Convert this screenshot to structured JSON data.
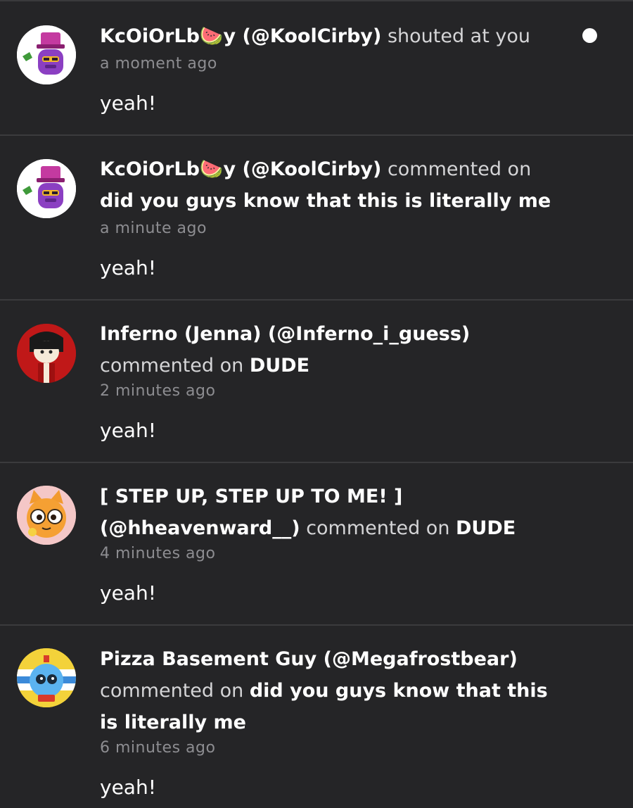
{
  "notifications": [
    {
      "author": "KcOiOrLb🍉y (@KoolCirby)",
      "action": " shouted at you",
      "target": "",
      "time": "a moment ago",
      "message": "yeah!",
      "unread": true,
      "avatar_icon": "purple-wizard-avatar-icon"
    },
    {
      "author": "KcOiOrLb🍉y (@KoolCirby)",
      "action": " commented on ",
      "target": "did you guys know that this is literally me",
      "time": "a minute ago",
      "message": "yeah!",
      "unread": false,
      "avatar_icon": "purple-wizard-avatar-icon"
    },
    {
      "author": "Inferno (Jenna) (@Inferno_i_guess)",
      "action": " commented on ",
      "target": "DUDE",
      "time": "2 minutes ago",
      "message": "yeah!",
      "unread": false,
      "avatar_icon": "red-character-avatar-icon"
    },
    {
      "author": "[ STEP UP, STEP UP TO ME! ] (@hheavenward__)",
      "action": " commented on ",
      "target": "DUDE",
      "time": "4 minutes ago",
      "message": "yeah!",
      "unread": false,
      "avatar_icon": "orange-cat-avatar-icon"
    },
    {
      "author": "Pizza Basement Guy (@Megafrostbear)",
      "action": " commented on ",
      "target": "did you guys know that this is literally me",
      "time": "6 minutes ago",
      "message": "yeah!",
      "unread": false,
      "avatar_icon": "blue-robot-avatar-icon"
    }
  ],
  "colors": {
    "background": "#252527",
    "separator": "#3b3b3d",
    "text_primary": "#ffffff",
    "text_secondary": "#d5d5d7",
    "text_muted": "#8d8d91"
  }
}
